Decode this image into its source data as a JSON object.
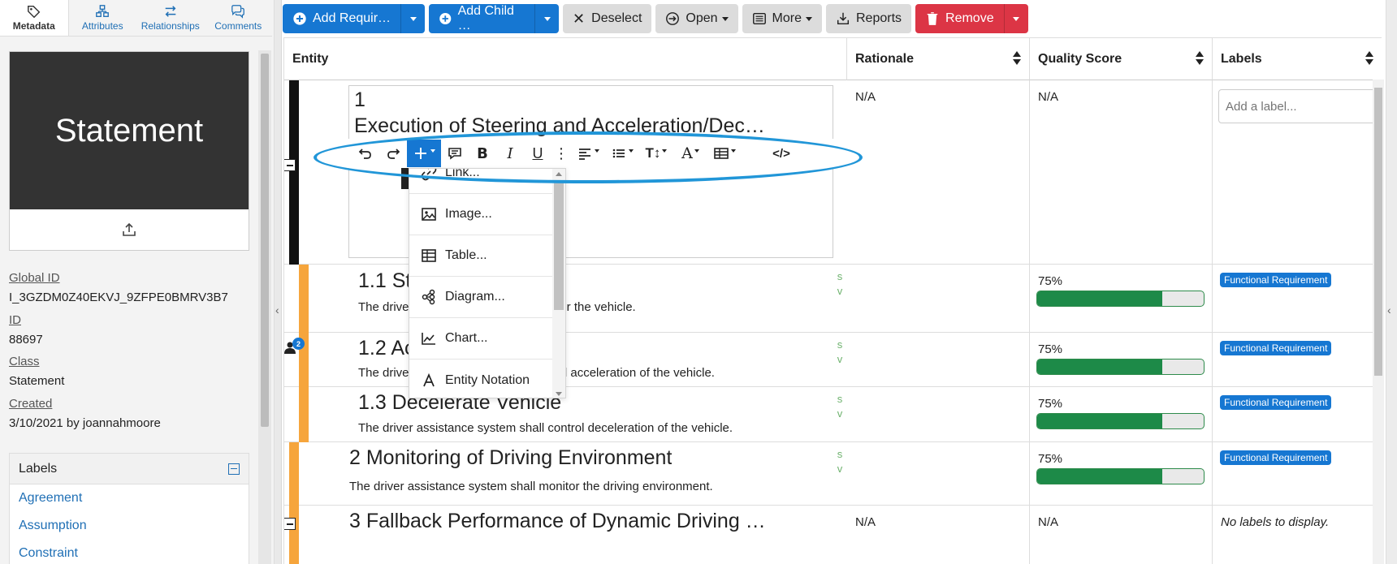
{
  "left_panel": {
    "tabs": [
      {
        "label": "Metadata",
        "active": true,
        "icon": "tag-icon"
      },
      {
        "label": "Attributes",
        "active": false,
        "icon": "attributes-icon"
      },
      {
        "label": "Relationships",
        "active": false,
        "icon": "relationships-icon"
      },
      {
        "label": "Comments",
        "active": false,
        "icon": "comments-icon"
      }
    ],
    "thumbnail_text": "Statement",
    "global_id_label": "Global ID",
    "global_id": "I_3GZDM0Z40EKVJ_9ZFPE0BMRV3B7",
    "id_label": "ID",
    "id": "88697",
    "class_label": "Class",
    "class": "Statement",
    "created_label": "Created",
    "created": "3/10/2021 by joannahmoore",
    "labels_header": "Labels",
    "labels": [
      "Agreement",
      "Assumption",
      "Constraint"
    ]
  },
  "toolbar": {
    "add_requirement": "Add Requir…",
    "add_child": "Add Child …",
    "deselect": "Deselect",
    "open": "Open",
    "more": "More",
    "reports": "Reports",
    "remove": "Remove"
  },
  "grid": {
    "headers": {
      "entity": "Entity",
      "rationale": "Rationale",
      "quality": "Quality Score",
      "labels": "Labels"
    },
    "label_placeholder": "Add a label...",
    "editor": {
      "number": "1",
      "title": "Execution of Steering and Acceleration/Dec…"
    },
    "rows": [
      {
        "title": "1.1 St",
        "desc": "The driver",
        "desc_tail": "eer the vehicle.",
        "quality": "75%",
        "quality_value": 75,
        "label": "Functional Requirement"
      },
      {
        "title": "1.2 Ac",
        "desc": "The drive",
        "desc_tail": "ntrol acceleration of the vehicle.",
        "quality": "75%",
        "quality_value": 75,
        "label": "Functional Requirement"
      },
      {
        "title": "1.3 Decelerate Vehicle",
        "desc": "The driver assistance system shall control deceleration of the vehicle.",
        "quality": "75%",
        "quality_value": 75,
        "label": "Functional Requirement"
      },
      {
        "title": "2 Monitoring of Driving Environment",
        "desc": "The driver assistance system shall monitor the driving environment.",
        "quality": "75%",
        "quality_value": 75,
        "label": "Functional Requirement"
      },
      {
        "title": "3 Fallback Performance of Dynamic Driving …",
        "rationale": "N/A",
        "quality": "N/A",
        "no_labels": "No labels to display."
      }
    ],
    "na": "N/A",
    "sv_s": "s",
    "sv_v": "v",
    "assignee_count": "2"
  },
  "insert_menu": {
    "items": [
      "Link...",
      "Image...",
      "Table...",
      "Diagram...",
      "Chart...",
      "Entity Notation"
    ]
  },
  "colors": {
    "primary": "#1677d2",
    "danger": "#dc3545",
    "success": "#1d8a48",
    "highlight": "#2196d8",
    "row_orange": "#f6a53c"
  }
}
